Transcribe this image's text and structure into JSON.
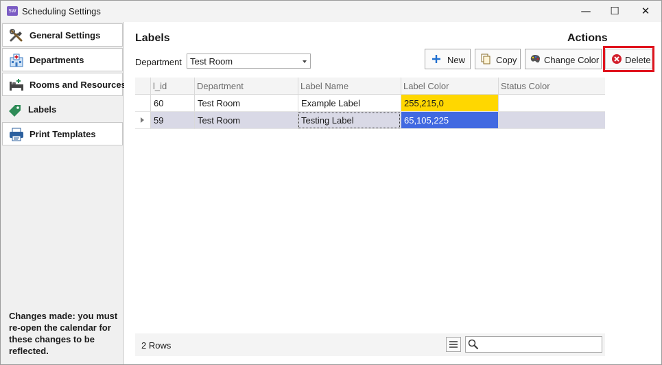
{
  "window": {
    "title": "Scheduling Settings",
    "app_icon_text": "SW",
    "minimize": "—",
    "maximize": "☐",
    "close": "✕"
  },
  "sidebar": {
    "items": [
      {
        "label": "General Settings",
        "icon": "tools-icon"
      },
      {
        "label": "Departments",
        "icon": "hospital-icon"
      },
      {
        "label": "Rooms and Resources",
        "icon": "bed-icon"
      },
      {
        "label": "Labels",
        "icon": "tag-icon",
        "active": true
      },
      {
        "label": "Print Templates",
        "icon": "printer-icon"
      }
    ],
    "note": "Changes made: you must re-open the calendar for these changes to be reflected."
  },
  "main": {
    "labels_title": "Labels",
    "actions_title": "Actions",
    "department_label": "Department",
    "department_value": "Test Room",
    "buttons": {
      "new": "New",
      "copy": "Copy",
      "change_color": "Change Color",
      "delete": "Delete"
    },
    "table": {
      "columns": [
        "l_id",
        "Department",
        "Label Name",
        "Label Color",
        "Status Color"
      ],
      "rows": [
        {
          "l_id": "60",
          "department": "Test Room",
          "label_name": "Example Label",
          "label_color": "255,215,0",
          "status_color": "",
          "label_color_hex": "#ffd700"
        },
        {
          "l_id": "59",
          "department": "Test Room",
          "label_name": "Testing Label",
          "label_color": "65,105,225",
          "status_color": "",
          "label_color_hex": "#4169e1",
          "selected": true
        }
      ]
    },
    "footer": {
      "row_count": "2 Rows"
    }
  },
  "colors": {
    "accent_highlight": "#e0141e",
    "selected_row": "#d9d9e6",
    "tag_green": "#2e8b57",
    "new_plus": "#1f6fd0",
    "delete_red": "#d21f2c"
  }
}
